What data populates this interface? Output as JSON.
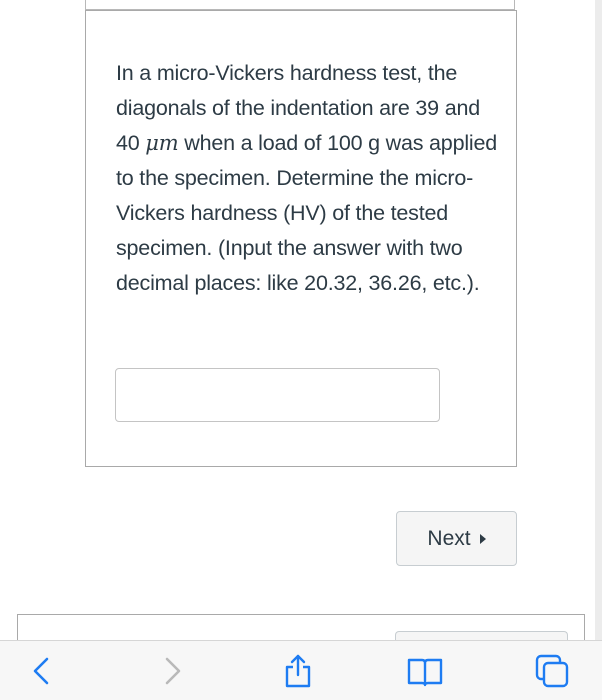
{
  "question": {
    "text_part1": "In a micro-Vickers hardness test, the diagonals of the indentation are 39 and 40 ",
    "unit": "μm",
    "text_part2": " when a load of 100 g was applied to the specimen. Determine the micro-Vickers hardness (HV) of the tested specimen. (Input the answer with two decimal places: like 20.32, 36.26, etc.).",
    "answer_value": "",
    "answer_placeholder": ""
  },
  "navigation": {
    "next_label": "Next",
    "next_icon": "triangle-right-icon"
  },
  "browser_toolbar": {
    "back_icon": "chevron-left-icon",
    "forward_icon": "chevron-right-icon",
    "share_icon": "share-icon",
    "bookmarks_icon": "book-icon",
    "tabs_icon": "tabs-icon",
    "accent_color": "#1e7cf2",
    "disabled_color": "#b9b9b9"
  },
  "colors": {
    "text": "#2d3b45",
    "card_border": "#a9a9a9",
    "button_bg": "#f5f5f5"
  }
}
